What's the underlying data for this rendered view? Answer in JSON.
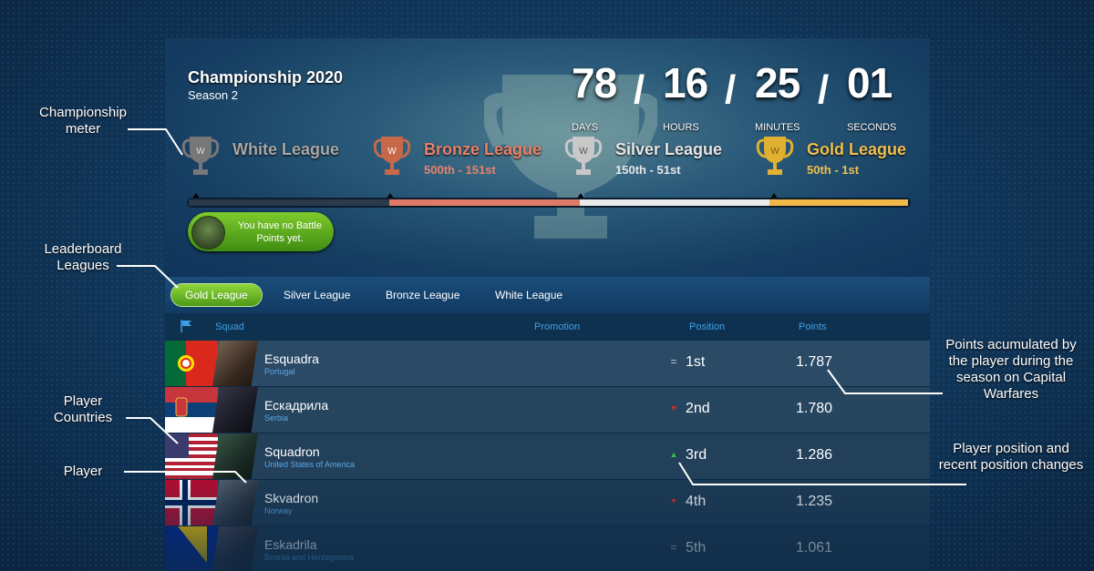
{
  "header": {
    "title": "Championship 2020",
    "season": "Season 2"
  },
  "timer": [
    {
      "value": "78",
      "label": "DAYS"
    },
    {
      "value": "16",
      "label": "HOURS"
    },
    {
      "value": "25",
      "label": "MINUTES"
    },
    {
      "value": "01",
      "label": "SECONDS"
    }
  ],
  "timer_separator": "/",
  "leagues": [
    {
      "name": "White League",
      "range": "",
      "color": "#a8a8a8"
    },
    {
      "name": "Bronze League",
      "range": "500th - 151st",
      "color": "#e8826a"
    },
    {
      "name": "Silver League",
      "range": "150th - 51st",
      "color": "#e6e6e6"
    },
    {
      "name": "Gold League",
      "range": "50th - 1st",
      "color": "#f0c050"
    }
  ],
  "battle_points": {
    "message": "You have no Battle Points yet."
  },
  "tabs": [
    "Gold League",
    "Silver League",
    "Bronze League",
    "White League"
  ],
  "active_tab": "Gold League",
  "columns": {
    "squad": "Squad",
    "promotion": "Promotion",
    "position": "Position",
    "points": "Points"
  },
  "players": [
    {
      "name": "Esquadra",
      "country": "Portugal",
      "change": "=",
      "change_type": "same",
      "position": "1st",
      "points": "1.787"
    },
    {
      "name": "Ескадрила",
      "country": "Serbia",
      "change": "▼",
      "change_type": "down",
      "position": "2nd",
      "points": "1.780"
    },
    {
      "name": "Squadron",
      "country": "United States of America",
      "change": "▲",
      "change_type": "up",
      "position": "3rd",
      "points": "1.286"
    },
    {
      "name": "Skvadron",
      "country": "Norway",
      "change": "▼",
      "change_type": "down",
      "position": "4th",
      "points": "1.235"
    },
    {
      "name": "Eskadrila",
      "country": "Bosnia and Herzegovina",
      "change": "=",
      "change_type": "same",
      "position": "5th",
      "points": "1.061"
    }
  ],
  "callouts": {
    "championship_meter": "Championship meter",
    "leaderboard_leagues": "Leaderboard Leagues",
    "player_countries": "Player Countries",
    "player": "Player",
    "points_info": "Points acumulated by the player during the season on Capital Warfares",
    "position_info": "Player position and recent position changes"
  },
  "colors": {
    "accent_green": "#6cc022",
    "link_blue": "#3da0e8",
    "up": "#39c44a",
    "down": "#d42a2a"
  }
}
